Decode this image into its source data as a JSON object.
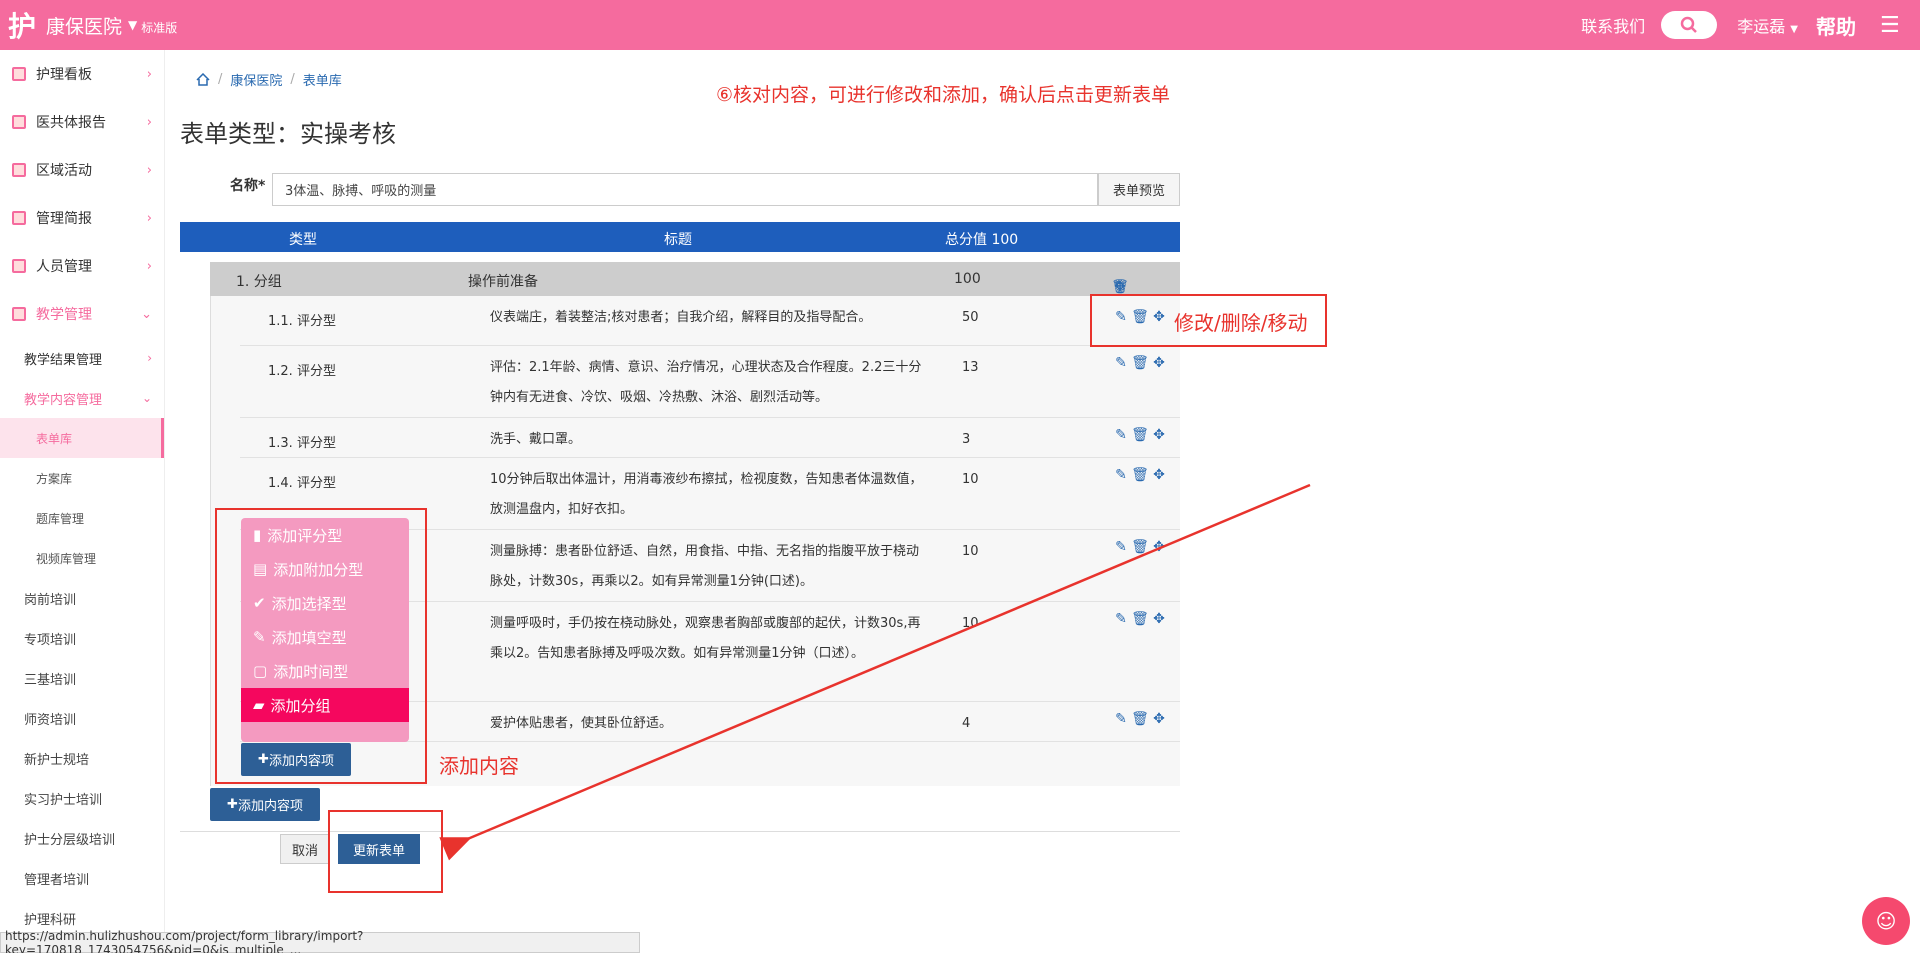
{
  "topbar": {
    "logo": "护",
    "hospital": "康保医院",
    "edition": "标准版",
    "contact": "联系我们",
    "user": "李运磊",
    "help": "帮助"
  },
  "sidebar": {
    "main": [
      {
        "label": "护理看板"
      },
      {
        "label": "医共体报告"
      },
      {
        "label": "区域活动"
      },
      {
        "label": "管理简报"
      },
      {
        "label": "人员管理"
      },
      {
        "label": "教学管理"
      }
    ],
    "sub": [
      {
        "label": "教学结果管理"
      },
      {
        "label": "教学内容管理"
      }
    ],
    "leaves": [
      {
        "label": "表单库"
      },
      {
        "label": "方案库"
      },
      {
        "label": "题库管理"
      },
      {
        "label": "视频库管理"
      }
    ],
    "plain": [
      {
        "label": "岗前培训"
      },
      {
        "label": "专项培训"
      },
      {
        "label": "三基培训"
      },
      {
        "label": "师资培训"
      },
      {
        "label": "新护士规培"
      },
      {
        "label": "实习护士培训"
      },
      {
        "label": "护士分层级培训"
      },
      {
        "label": "管理者培训"
      },
      {
        "label": "护理科研"
      }
    ]
  },
  "breadcrumb": {
    "home": "康保医院",
    "current": "表单库"
  },
  "page": {
    "title": "表单类型：实操考核",
    "instruction": "⑥核对内容，可进行修改和添加，确认后点击更新表单",
    "name_label": "名称*",
    "name_value": "3体温、脉搏、呼吸的测量",
    "preview": "表单预览"
  },
  "table": {
    "head_type": "类型",
    "head_title": "标题",
    "head_total": "总分值 100",
    "group": {
      "type": "1. 分组",
      "title": "操作前准备",
      "score": "100"
    },
    "items": [
      {
        "type": "1.1. 评分型",
        "title": "仪表端庄，着装整洁;核对患者；自我介绍，解释目的及指导配合。",
        "score": "50"
      },
      {
        "type": "1.2. 评分型",
        "title": "评估：2.1年龄、病情、意识、治疗情况，心理状态及合作程度。2.2三十分钟内有无进食、冷饮、吸烟、冷热敷、沐浴、剧烈活动等。",
        "score": "13"
      },
      {
        "type": "1.3. 评分型",
        "title": "洗手、戴口罩。",
        "score": "3"
      },
      {
        "type": "1.4. 评分型",
        "title": "10分钟后取出体温计，用消毒液纱布擦拭，检视度数，告知患者体温数值，放测温盘内，扣好衣扣。",
        "score": "10"
      },
      {
        "type": "",
        "title": "测量脉搏：患者卧位舒适、自然，用食指、中指、无名指的指腹平放于桡动脉处，计数30s，再乘以2。如有异常测量1分钟(口述)。",
        "score": "10"
      },
      {
        "type": "",
        "title": "测量呼吸时，手仍按在桡动脉处，观察患者胸部或腹部的起伏，计数30s,再乘以2。告知患者脉搏及呼吸次数。如有异常测量1分钟（口述）。",
        "score": "10"
      },
      {
        "type": "",
        "title": "爱护体贴患者，使其卧位舒适。",
        "score": "4"
      }
    ]
  },
  "popup": [
    {
      "label": "添加评分型",
      "icon": "bar-chart-icon"
    },
    {
      "label": "添加附加分型",
      "icon": "stack-icon"
    },
    {
      "label": "添加选择型",
      "icon": "check-circle-icon"
    },
    {
      "label": "添加填空型",
      "icon": "pencil-icon"
    },
    {
      "label": "添加时间型",
      "icon": "square-icon"
    },
    {
      "label": "添加分组",
      "icon": "folder-icon"
    }
  ],
  "buttons": {
    "add_content_inner": "添加内容项",
    "add_content_outer": "添加内容项",
    "cancel": "取消",
    "update": "更新表单"
  },
  "annotations": {
    "edit_delete_move": "修改/删除/移动",
    "add_content": "添加内容"
  },
  "statusbar": "https://admin.hulizhushou.com/project/form_library/import?key=170818_1743054756&pid=0&is_multiple_...",
  "colors": {
    "brand": "#f56b9e",
    "header_blue": "#1e5ebc",
    "btn_blue": "#2d5f96",
    "annotation_red": "#e8332d"
  }
}
